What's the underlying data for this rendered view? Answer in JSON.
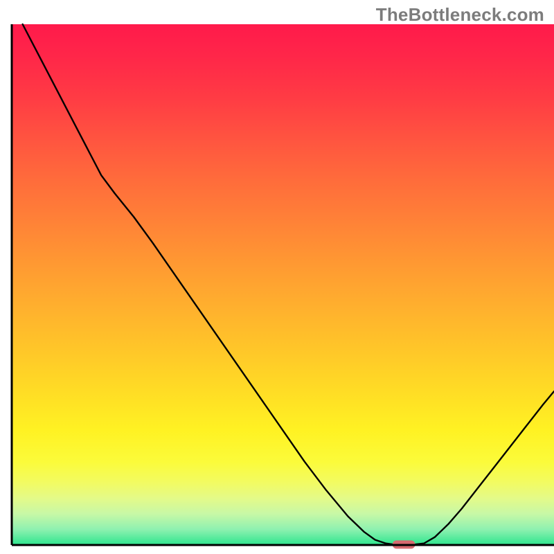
{
  "watermark": "TheBottleneck.com",
  "chart_data": {
    "type": "line",
    "title": "",
    "xlabel": "",
    "ylabel": "",
    "xlim": [
      0,
      100
    ],
    "ylim": [
      0,
      100
    ],
    "background_gradient": {
      "stops": [
        {
          "offset": 0.0,
          "color": "#ff1a4b"
        },
        {
          "offset": 0.06,
          "color": "#ff2649"
        },
        {
          "offset": 0.14,
          "color": "#ff3b44"
        },
        {
          "offset": 0.22,
          "color": "#ff5440"
        },
        {
          "offset": 0.3,
          "color": "#ff6c3b"
        },
        {
          "offset": 0.38,
          "color": "#ff8237"
        },
        {
          "offset": 0.46,
          "color": "#ff9932"
        },
        {
          "offset": 0.54,
          "color": "#ffaf2e"
        },
        {
          "offset": 0.62,
          "color": "#ffc529"
        },
        {
          "offset": 0.7,
          "color": "#ffdb25"
        },
        {
          "offset": 0.78,
          "color": "#fff223"
        },
        {
          "offset": 0.84,
          "color": "#fbfb3a"
        },
        {
          "offset": 0.88,
          "color": "#f2fb62"
        },
        {
          "offset": 0.91,
          "color": "#e4fa88"
        },
        {
          "offset": 0.94,
          "color": "#c8f8a6"
        },
        {
          "offset": 0.97,
          "color": "#8ef1b0"
        },
        {
          "offset": 1.0,
          "color": "#2de58e"
        }
      ]
    },
    "series": [
      {
        "name": "bottleneck-curve",
        "type": "line",
        "color": "#000000",
        "points": [
          {
            "x": 2.0,
            "y": 100.0
          },
          {
            "x": 4.5,
            "y": 95.0
          },
          {
            "x": 7.0,
            "y": 90.0
          },
          {
            "x": 9.5,
            "y": 85.0
          },
          {
            "x": 12.0,
            "y": 80.0
          },
          {
            "x": 14.5,
            "y": 75.0
          },
          {
            "x": 16.5,
            "y": 71.0
          },
          {
            "x": 19.0,
            "y": 67.5
          },
          {
            "x": 22.5,
            "y": 63.0
          },
          {
            "x": 26.0,
            "y": 58.0
          },
          {
            "x": 30.0,
            "y": 52.0
          },
          {
            "x": 34.0,
            "y": 46.0
          },
          {
            "x": 38.0,
            "y": 40.0
          },
          {
            "x": 42.0,
            "y": 34.0
          },
          {
            "x": 46.0,
            "y": 28.0
          },
          {
            "x": 50.0,
            "y": 22.0
          },
          {
            "x": 54.0,
            "y": 16.0
          },
          {
            "x": 58.0,
            "y": 10.5
          },
          {
            "x": 62.0,
            "y": 5.5
          },
          {
            "x": 65.0,
            "y": 2.5
          },
          {
            "x": 67.0,
            "y": 1.0
          },
          {
            "x": 69.0,
            "y": 0.3
          },
          {
            "x": 71.0,
            "y": 0.0
          },
          {
            "x": 73.5,
            "y": 0.0
          },
          {
            "x": 76.0,
            "y": 0.3
          },
          {
            "x": 78.0,
            "y": 1.5
          },
          {
            "x": 80.5,
            "y": 4.0
          },
          {
            "x": 83.0,
            "y": 7.0
          },
          {
            "x": 86.0,
            "y": 11.0
          },
          {
            "x": 89.0,
            "y": 15.0
          },
          {
            "x": 92.0,
            "y": 19.0
          },
          {
            "x": 95.0,
            "y": 23.0
          },
          {
            "x": 98.0,
            "y": 27.0
          },
          {
            "x": 100.0,
            "y": 29.5
          }
        ]
      }
    ],
    "marker": {
      "name": "optimum-marker",
      "x_center": 72.3,
      "y": 0.0,
      "width": 4.2,
      "height": 1.6,
      "color": "#d66a6f"
    },
    "axes": {
      "left": {
        "color": "#000000",
        "width": 3
      },
      "bottom": {
        "color": "#000000",
        "width": 3
      }
    }
  }
}
